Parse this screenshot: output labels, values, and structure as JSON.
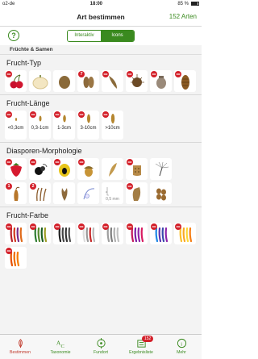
{
  "status": {
    "carrier": "o2-de",
    "time": "18:00",
    "battery": "85 %"
  },
  "nav": {
    "title": "Art bestimmen",
    "count": "152 Arten"
  },
  "help_label": "?",
  "segment": {
    "left": "Interaktiv",
    "right": "Icons"
  },
  "category": "Früchte & Samen",
  "sections": {
    "frucht_typ": {
      "title": "Frucht-Typ"
    },
    "frucht_laenge": {
      "title": "Frucht-Länge",
      "labels": [
        "<0,3cm",
        "0,3-1cm",
        "1-3cm",
        "3-10cm",
        ">10cm"
      ]
    },
    "diasporen": {
      "title": "Diasporen-Morphologie",
      "scale_label": "0,5 mm"
    },
    "frucht_farbe": {
      "title": "Frucht-Farbe"
    }
  },
  "badges": {
    "oo": "oo",
    "n2": "2",
    "n7": "7",
    "n1": "1"
  },
  "tabs": [
    {
      "label": "Bestimmen"
    },
    {
      "label": "Taxonomie"
    },
    {
      "label": "Fundort"
    },
    {
      "label": "Ergebnisliste",
      "count": "152"
    },
    {
      "label": "Mehr"
    }
  ],
  "colors": {
    "accent": "#3a8a1f",
    "badge": "#d3202a",
    "active_tab": "#c0392b"
  }
}
